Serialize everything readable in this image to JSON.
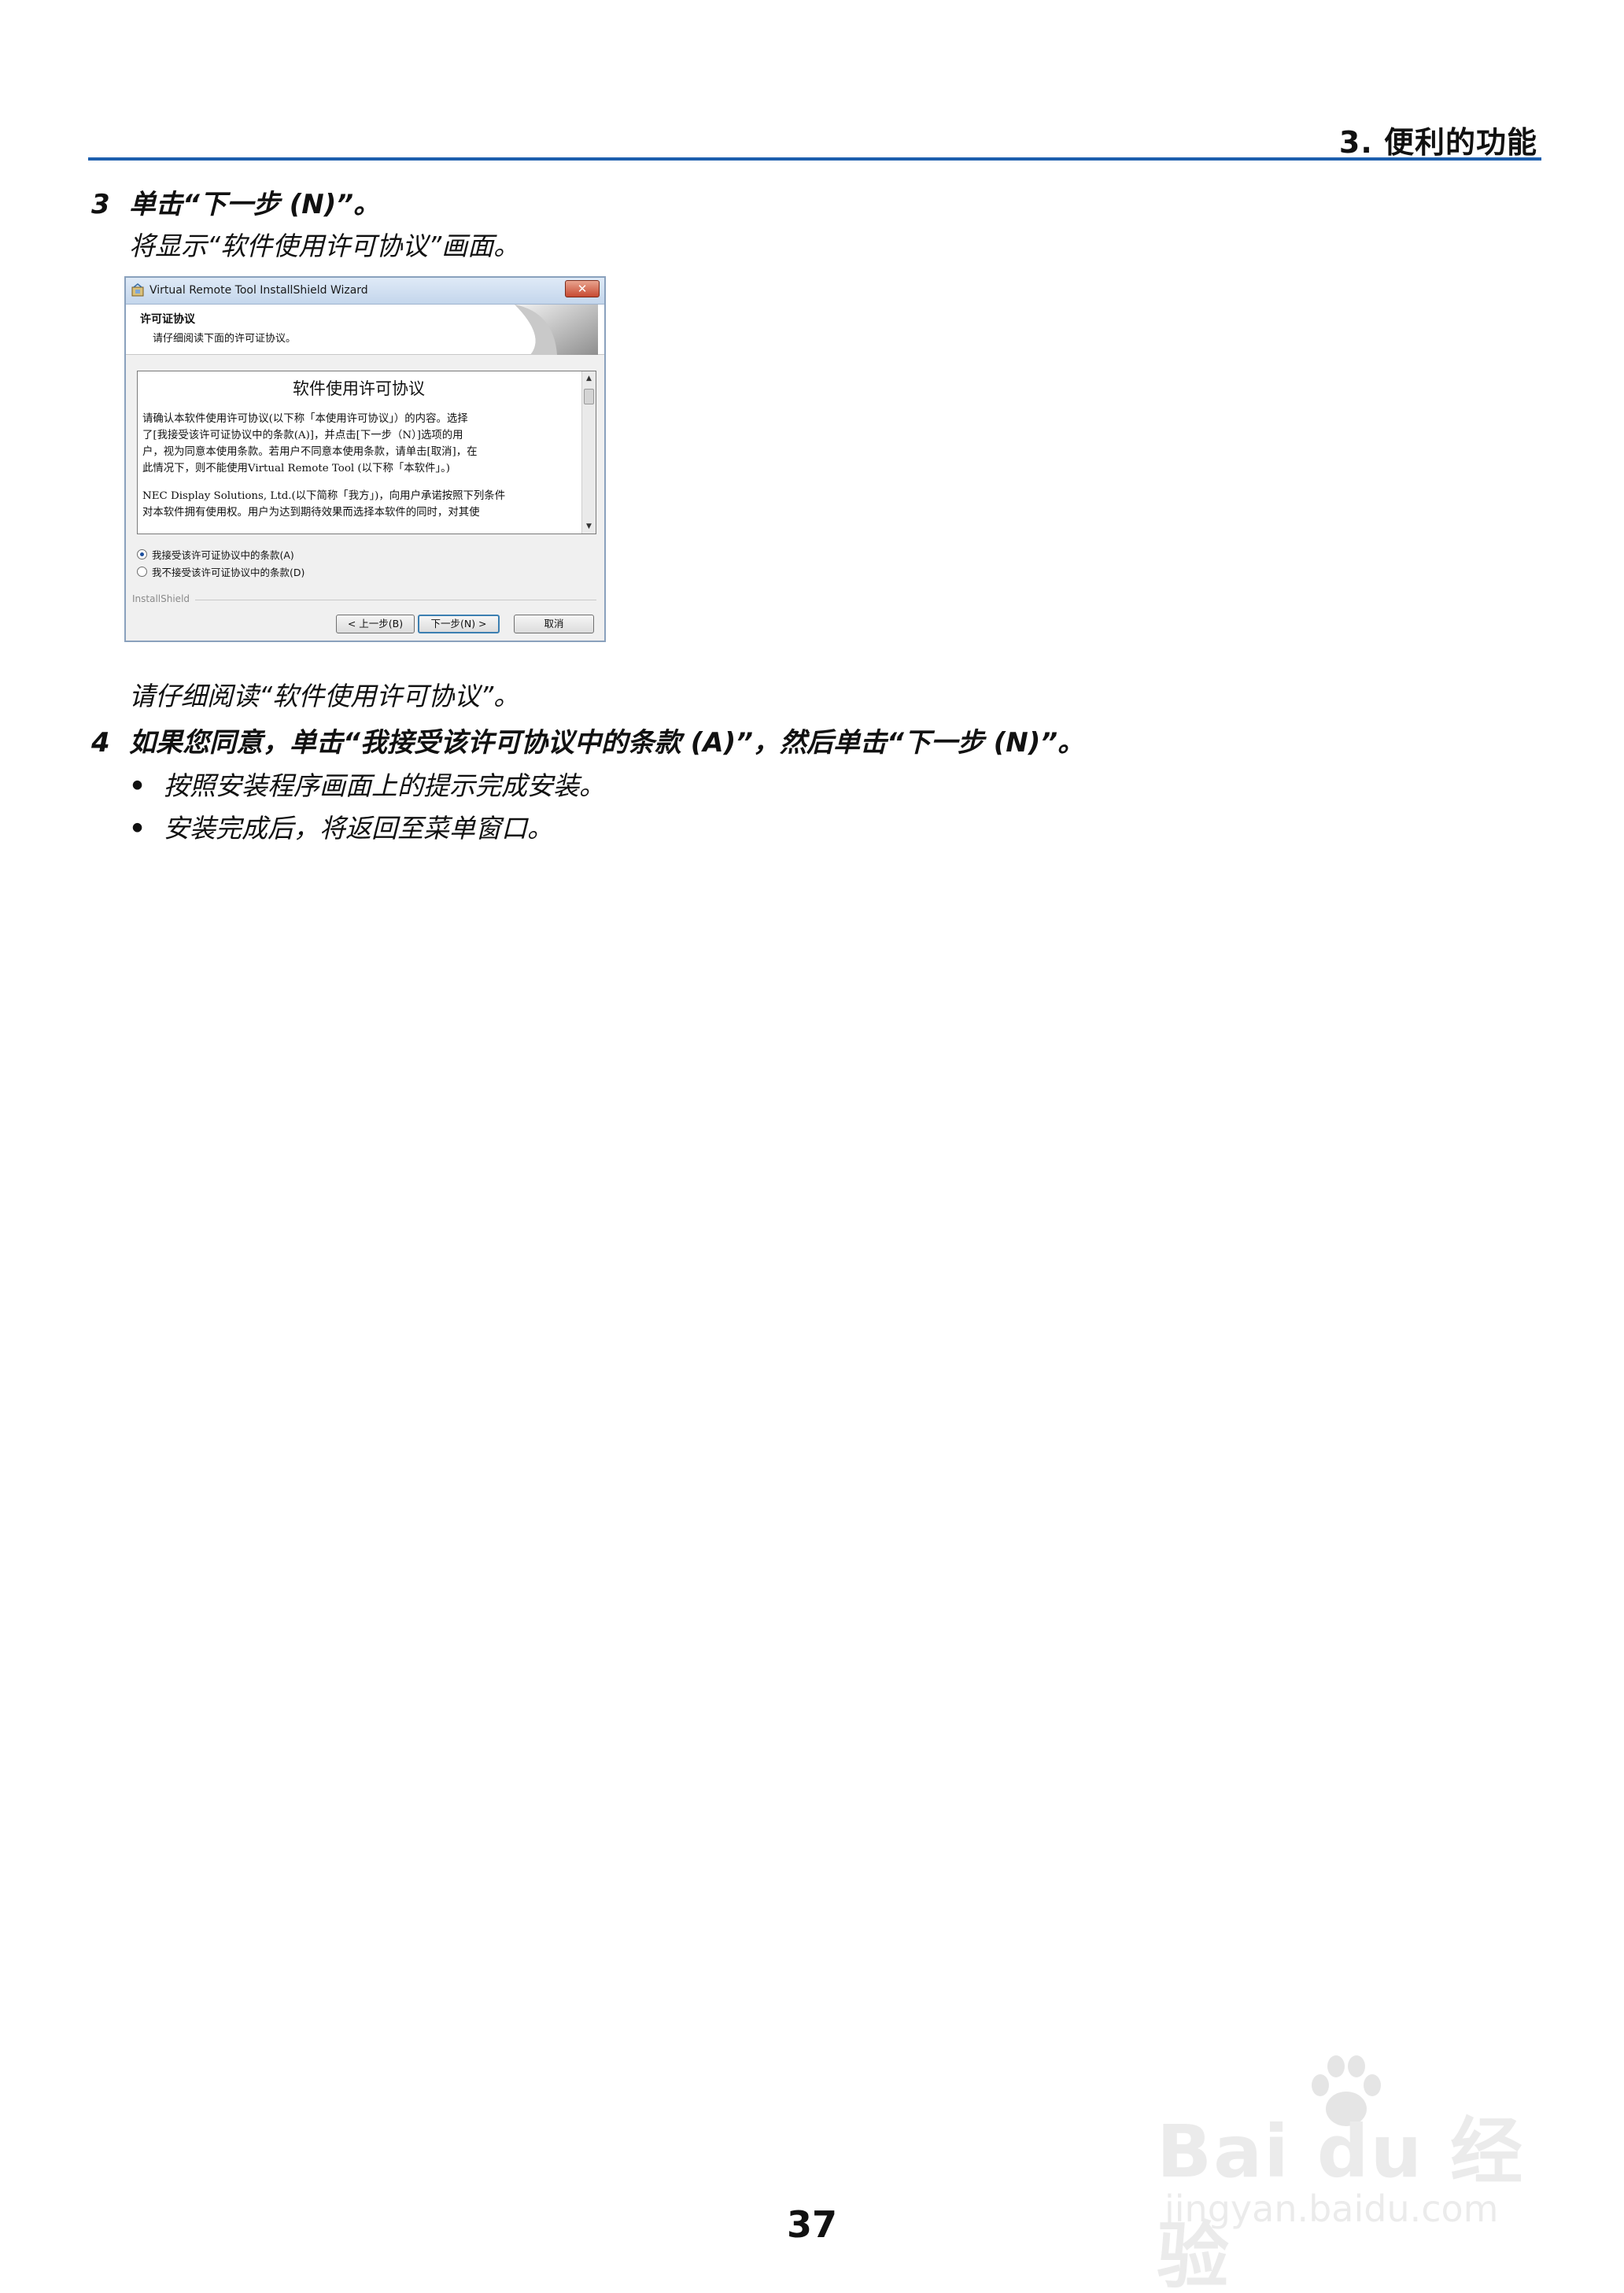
{
  "header": {
    "chapter_title": "3. 便利的功能"
  },
  "step3": {
    "number": "3",
    "instruction": "单击“下一步 (N)”。",
    "description": "将显示“软件使用许可协议”画面。"
  },
  "wizard": {
    "window_title": "Virtual Remote Tool InstallShield Wizard",
    "close_glyph": "✕",
    "banner_title": "许可证协议",
    "banner_subtitle": "请仔细阅读下面的许可证协议。",
    "license_heading": "软件使用许可协议",
    "license_lines": [
      "  请确认本软件使用许可协议(以下称「本使用许可协议」）的内容。选择",
      "了[我接受该许可证协议中的条款(A)]，并点击[下一步（N）]选项的用",
      "户，视为同意本使用条款。若用户不同意本使用条款，请单击[取消]，在",
      "此情况下，则不能使用Virtual Remote Tool (以下称「本软件」。)"
    ],
    "license_lines_2": [
      "NEC Display Solutions, Ltd.(以下简称「我方」)，向用户承诺按照下列条件",
      "对本软件拥有使用权。用户为达到期待效果而选择本软件的同时，对其使"
    ],
    "radio_accept": "我接受该许可证协议中的条款(A)",
    "radio_decline": "我不接受该许可证协议中的条款(D)",
    "radio_selected": "accept",
    "installshield_label": "InstallShield",
    "back_button": "< 上一步(B)",
    "next_button": "下一步(N) >",
    "cancel_button": "取消"
  },
  "read_note": "请仔细阅读“软件使用许可协议”。",
  "step4": {
    "number": "4",
    "instruction": "如果您同意，单击“我接受该许可协议中的条款 (A)”，然后单击“下一步 (N)”。",
    "bullets": [
      "按照安装程序画面上的提示完成安装。",
      "安装完成后，将返回至菜单窗口。"
    ]
  },
  "page_number": "37",
  "watermark": {
    "logo_text": "Bai du 经验",
    "url": "jingyan.baidu.com"
  },
  "colors": {
    "rule": "#1d5fae"
  }
}
